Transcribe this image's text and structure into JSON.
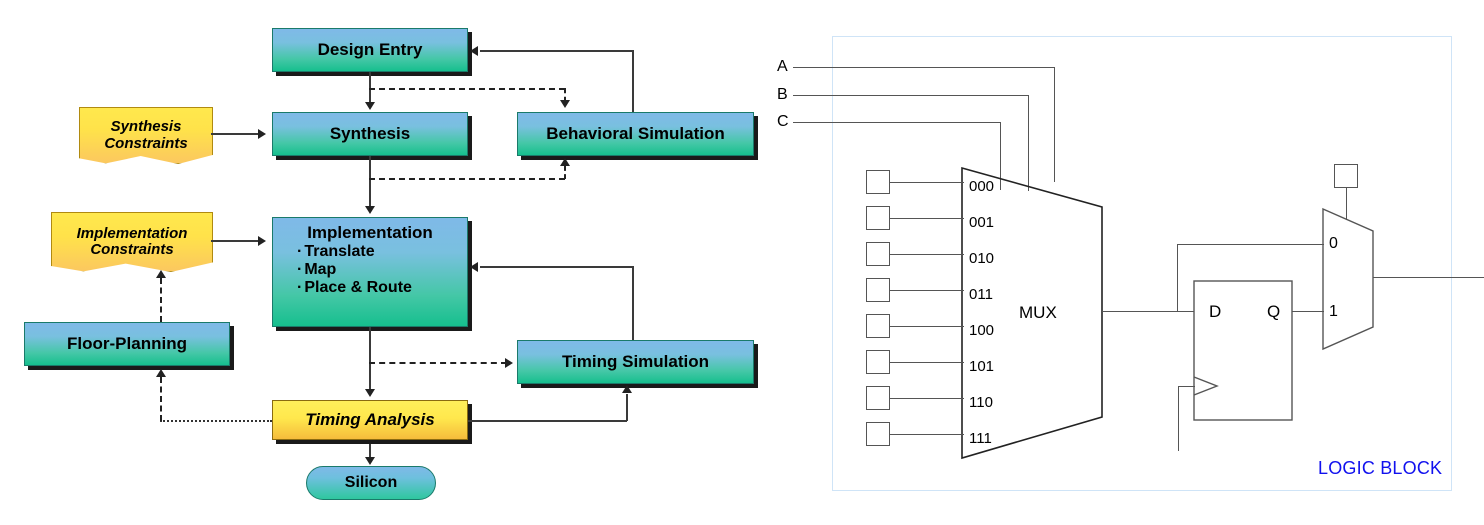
{
  "flow": {
    "nodes": {
      "design_entry": "Design Entry",
      "synthesis": "Synthesis",
      "behavioral_simulation": "Behavioral Simulation",
      "implementation_title": "Implementation",
      "implementation_steps": [
        "Translate",
        "Map",
        "Place & Route"
      ],
      "floor_planning": "Floor-Planning",
      "timing_simulation": "Timing Simulation",
      "timing_analysis": "Timing Analysis",
      "silicon": "Silicon",
      "synthesis_constraints_line1": "Synthesis",
      "synthesis_constraints_line2": "Constraints",
      "implementation_constraints_line1": "Implementation",
      "implementation_constraints_line2": "Constraints"
    },
    "colors": {
      "process_top": "#7fb9e8",
      "process_bottom": "#16bf8e",
      "note_top": "#ffe84d",
      "note_bottom": "#fbc85f",
      "timing_top": "#ffef5a",
      "timing_bottom": "#f5bc3c",
      "shadow": "#1a1a1a",
      "connector": "#3a3a3a"
    }
  },
  "logic_block": {
    "caption": "LOGIC BLOCK",
    "caption_color": "#1111ee",
    "border_color": "#cfe4f7",
    "select_inputs": [
      "A",
      "B",
      "C"
    ],
    "mux_label": "MUX",
    "mux_input_labels": [
      "000",
      "001",
      "010",
      "011",
      "100",
      "101",
      "110",
      "111"
    ],
    "config_cell_count": 8,
    "flipflop": {
      "d_label": "D",
      "q_label": "Q"
    },
    "output_mux_labels": [
      "0",
      "1"
    ]
  }
}
